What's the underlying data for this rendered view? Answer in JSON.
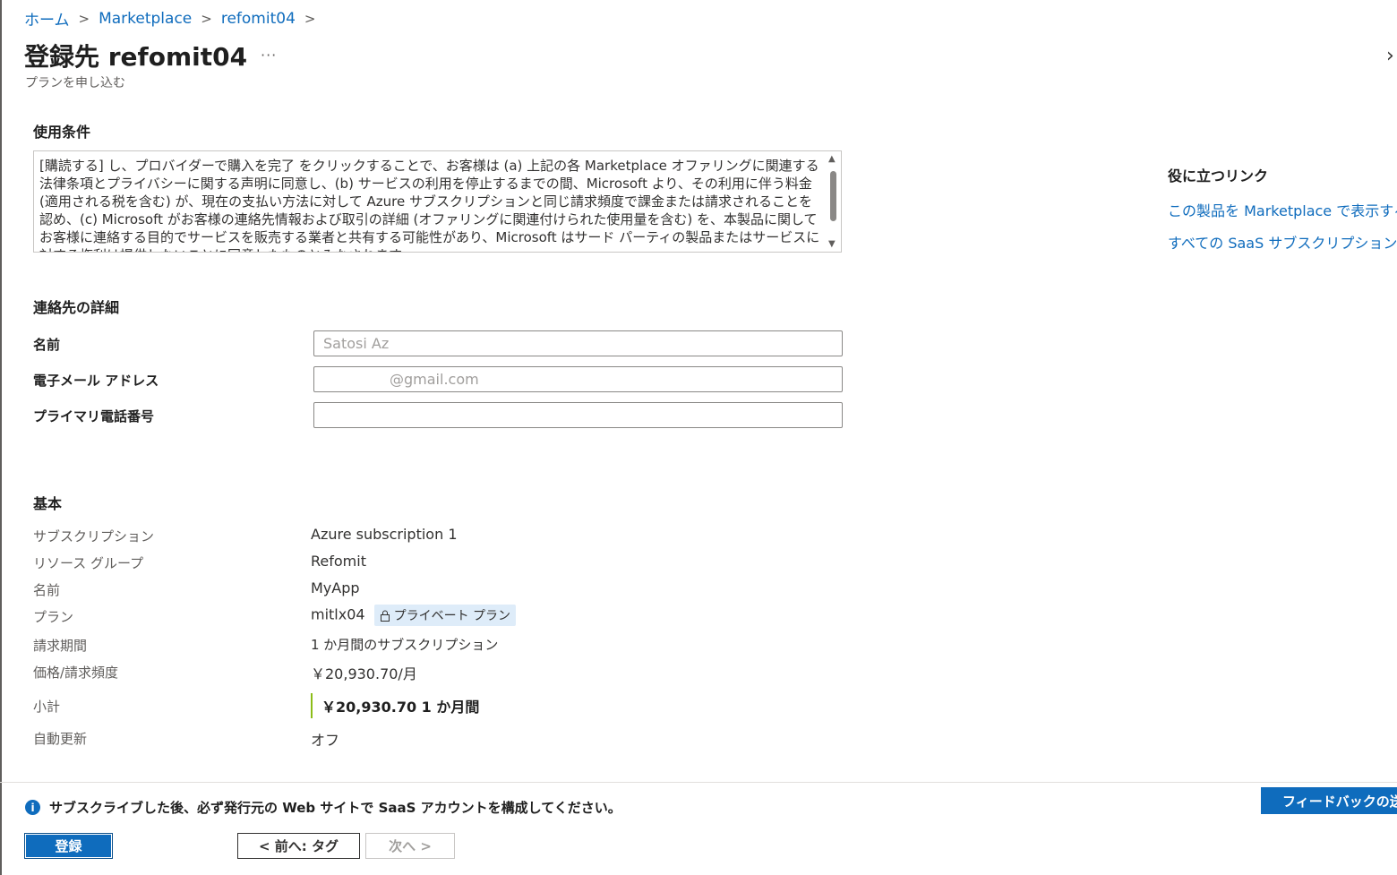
{
  "breadcrumb": {
    "home": "ホーム",
    "marketplace": "Marketplace",
    "current": "refomit04",
    "sep": ">"
  },
  "header": {
    "title": "登録先 refomit04",
    "more": "···",
    "subtitle": "プランを申し込む",
    "expand": "›"
  },
  "terms": {
    "heading": "使用条件",
    "text": "[購読する] し、プロバイダーで購入を完了 をクリックすることで、お客様は (a) 上記の各 Marketplace オファリングに関連する法律条項とプライバシーに関する声明に同意し、(b) サービスの利用を停止するまでの間、Microsoft より、その利用に伴う料金 (適用される税を含む) が、現在の支払い方法に対して Azure サブスクリプションと同じ請求頻度で課金または請求されることを認め、(c) Microsoft がお客様の連絡先情報および取引の詳細 (オファリングに関連付けられた使用量を含む) を、本製品に関してお客様に連絡する目的でサービスを販売する業者と共有する可能性があり、Microsoft はサード パーティの製品またはサービスに対する権利は提供しないことに同意したものとみなされます。"
  },
  "helpful_links": {
    "heading": "役に立つリンク",
    "view_in_marketplace": "この製品を Marketplace で表示する",
    "all_saas": "すべての SaaS サブスクリプションを表示"
  },
  "contact": {
    "heading": "連絡先の詳細",
    "name_label": "名前",
    "name_value": "Satosi Az",
    "email_label": "電子メール アドレス",
    "email_value": "@gmail.com",
    "phone_label": "プライマリ電話番号",
    "phone_value": ""
  },
  "basics": {
    "heading": "基本",
    "rows": [
      {
        "label": "サブスクリプション",
        "value": "Azure subscription 1"
      },
      {
        "label": "リソース グループ",
        "value": "Refomit"
      },
      {
        "label": "名前",
        "value": "MyApp"
      },
      {
        "label": "プラン",
        "value": "mitlx04",
        "badge": "プライベート プラン"
      },
      {
        "label": "請求期間",
        "value": "1 か月間のサブスクリプション"
      },
      {
        "label": "価格/請求頻度",
        "value": "￥20,930.70/月"
      }
    ],
    "subtotal_label": "小計",
    "subtotal_value": "￥20,930.70 1 か月間",
    "autorenew_label": "自動更新",
    "autorenew_value": "オフ"
  },
  "footer": {
    "info": "サブスクライブした後、必ず発行元の Web サイトで SaaS アカウントを構成してください。",
    "register": "登録",
    "prev": "< 前へ: タグ",
    "next": "次へ >",
    "feedback": "フィードバックの送信"
  },
  "colors": {
    "accent": "#0f6cbd",
    "subtotal_bar": "#8cbd18",
    "badge_bg": "#deecf9"
  }
}
